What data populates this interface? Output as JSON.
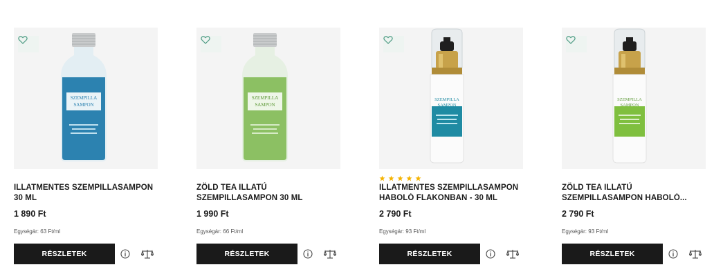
{
  "accent_color": "#1a1a1a",
  "star_color": "#f5b301",
  "products": [
    {
      "title_line1": "ILLATMENTES SZEMPILLASAMPON",
      "title_line2": "30 ML",
      "price": "1 890 Ft",
      "unit_price": "Egységár: 63 Ft/ml",
      "button_label": "RÉSZLETEK",
      "rating": null,
      "image": {
        "type": "bottle",
        "liquid": "#2c82b0",
        "cap": "aluminium",
        "label_text": [
          "SZEMPILLA",
          "SAMPON"
        ]
      }
    },
    {
      "title_line1": "ZÖLD TEA ILLATÚ",
      "title_line2": "SZEMPILLASAMPON 30 ML",
      "price": "1 990 Ft",
      "unit_price": "Egységár: 66 Ft/ml",
      "button_label": "RÉSZLETEK",
      "rating": null,
      "image": {
        "type": "bottle",
        "liquid": "#8cc063",
        "cap": "aluminium",
        "label_text": [
          "SZEMPILLA",
          "SAMPON"
        ]
      }
    },
    {
      "title_line1": "ILLATMENTES SZEMPILLASAMPON",
      "title_line2": "HABOLÓ FLAKONBAN - 30 ML",
      "price": "2 790 Ft",
      "unit_price": "Egységár: 93 Ft/ml",
      "button_label": "RÉSZLETEK",
      "rating": 5,
      "image": {
        "type": "foamer",
        "band": "#1f8ba3",
        "cap": "gold-pump",
        "label_text": [
          "SZEMPILLA",
          "SAMPON"
        ]
      }
    },
    {
      "title_line1": "ZÖLD TEA ILLATÚ",
      "title_line2": "SZEMPILLASAMPON HABOLÓ...",
      "price": "2 790 Ft",
      "unit_price": "Egységár: 93 Ft/ml",
      "button_label": "RÉSZLETEK",
      "rating": null,
      "image": {
        "type": "foamer",
        "band": "#7fbf3f",
        "cap": "gold-pump",
        "label_text": [
          "SZEMPILLA",
          "SAMPON"
        ]
      }
    }
  ]
}
